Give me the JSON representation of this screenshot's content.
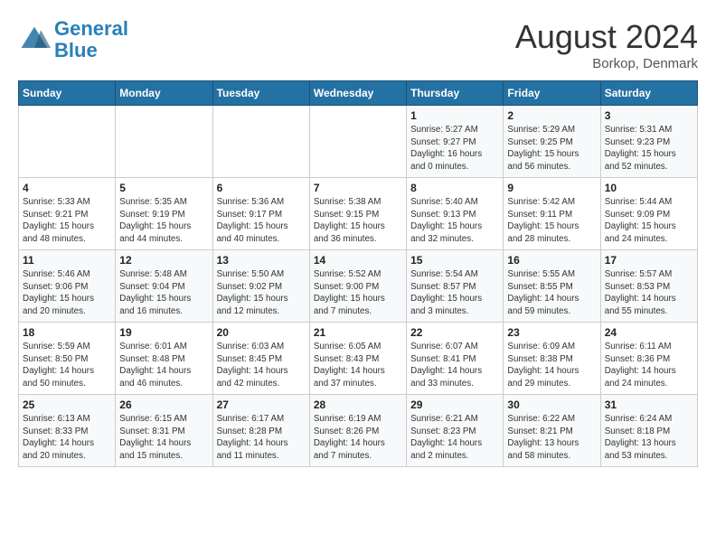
{
  "header": {
    "logo_line1": "General",
    "logo_line2": "Blue",
    "month": "August 2024",
    "location": "Borkop, Denmark"
  },
  "days_of_week": [
    "Sunday",
    "Monday",
    "Tuesday",
    "Wednesday",
    "Thursday",
    "Friday",
    "Saturday"
  ],
  "weeks": [
    [
      {
        "day": "",
        "info": ""
      },
      {
        "day": "",
        "info": ""
      },
      {
        "day": "",
        "info": ""
      },
      {
        "day": "",
        "info": ""
      },
      {
        "day": "1",
        "info": "Sunrise: 5:27 AM\nSunset: 9:27 PM\nDaylight: 16 hours\nand 0 minutes."
      },
      {
        "day": "2",
        "info": "Sunrise: 5:29 AM\nSunset: 9:25 PM\nDaylight: 15 hours\nand 56 minutes."
      },
      {
        "day": "3",
        "info": "Sunrise: 5:31 AM\nSunset: 9:23 PM\nDaylight: 15 hours\nand 52 minutes."
      }
    ],
    [
      {
        "day": "4",
        "info": "Sunrise: 5:33 AM\nSunset: 9:21 PM\nDaylight: 15 hours\nand 48 minutes."
      },
      {
        "day": "5",
        "info": "Sunrise: 5:35 AM\nSunset: 9:19 PM\nDaylight: 15 hours\nand 44 minutes."
      },
      {
        "day": "6",
        "info": "Sunrise: 5:36 AM\nSunset: 9:17 PM\nDaylight: 15 hours\nand 40 minutes."
      },
      {
        "day": "7",
        "info": "Sunrise: 5:38 AM\nSunset: 9:15 PM\nDaylight: 15 hours\nand 36 minutes."
      },
      {
        "day": "8",
        "info": "Sunrise: 5:40 AM\nSunset: 9:13 PM\nDaylight: 15 hours\nand 32 minutes."
      },
      {
        "day": "9",
        "info": "Sunrise: 5:42 AM\nSunset: 9:11 PM\nDaylight: 15 hours\nand 28 minutes."
      },
      {
        "day": "10",
        "info": "Sunrise: 5:44 AM\nSunset: 9:09 PM\nDaylight: 15 hours\nand 24 minutes."
      }
    ],
    [
      {
        "day": "11",
        "info": "Sunrise: 5:46 AM\nSunset: 9:06 PM\nDaylight: 15 hours\nand 20 minutes."
      },
      {
        "day": "12",
        "info": "Sunrise: 5:48 AM\nSunset: 9:04 PM\nDaylight: 15 hours\nand 16 minutes."
      },
      {
        "day": "13",
        "info": "Sunrise: 5:50 AM\nSunset: 9:02 PM\nDaylight: 15 hours\nand 12 minutes."
      },
      {
        "day": "14",
        "info": "Sunrise: 5:52 AM\nSunset: 9:00 PM\nDaylight: 15 hours\nand 7 minutes."
      },
      {
        "day": "15",
        "info": "Sunrise: 5:54 AM\nSunset: 8:57 PM\nDaylight: 15 hours\nand 3 minutes."
      },
      {
        "day": "16",
        "info": "Sunrise: 5:55 AM\nSunset: 8:55 PM\nDaylight: 14 hours\nand 59 minutes."
      },
      {
        "day": "17",
        "info": "Sunrise: 5:57 AM\nSunset: 8:53 PM\nDaylight: 14 hours\nand 55 minutes."
      }
    ],
    [
      {
        "day": "18",
        "info": "Sunrise: 5:59 AM\nSunset: 8:50 PM\nDaylight: 14 hours\nand 50 minutes."
      },
      {
        "day": "19",
        "info": "Sunrise: 6:01 AM\nSunset: 8:48 PM\nDaylight: 14 hours\nand 46 minutes."
      },
      {
        "day": "20",
        "info": "Sunrise: 6:03 AM\nSunset: 8:45 PM\nDaylight: 14 hours\nand 42 minutes."
      },
      {
        "day": "21",
        "info": "Sunrise: 6:05 AM\nSunset: 8:43 PM\nDaylight: 14 hours\nand 37 minutes."
      },
      {
        "day": "22",
        "info": "Sunrise: 6:07 AM\nSunset: 8:41 PM\nDaylight: 14 hours\nand 33 minutes."
      },
      {
        "day": "23",
        "info": "Sunrise: 6:09 AM\nSunset: 8:38 PM\nDaylight: 14 hours\nand 29 minutes."
      },
      {
        "day": "24",
        "info": "Sunrise: 6:11 AM\nSunset: 8:36 PM\nDaylight: 14 hours\nand 24 minutes."
      }
    ],
    [
      {
        "day": "25",
        "info": "Sunrise: 6:13 AM\nSunset: 8:33 PM\nDaylight: 14 hours\nand 20 minutes."
      },
      {
        "day": "26",
        "info": "Sunrise: 6:15 AM\nSunset: 8:31 PM\nDaylight: 14 hours\nand 15 minutes."
      },
      {
        "day": "27",
        "info": "Sunrise: 6:17 AM\nSunset: 8:28 PM\nDaylight: 14 hours\nand 11 minutes."
      },
      {
        "day": "28",
        "info": "Sunrise: 6:19 AM\nSunset: 8:26 PM\nDaylight: 14 hours\nand 7 minutes."
      },
      {
        "day": "29",
        "info": "Sunrise: 6:21 AM\nSunset: 8:23 PM\nDaylight: 14 hours\nand 2 minutes."
      },
      {
        "day": "30",
        "info": "Sunrise: 6:22 AM\nSunset: 8:21 PM\nDaylight: 13 hours\nand 58 minutes."
      },
      {
        "day": "31",
        "info": "Sunrise: 6:24 AM\nSunset: 8:18 PM\nDaylight: 13 hours\nand 53 minutes."
      }
    ]
  ]
}
